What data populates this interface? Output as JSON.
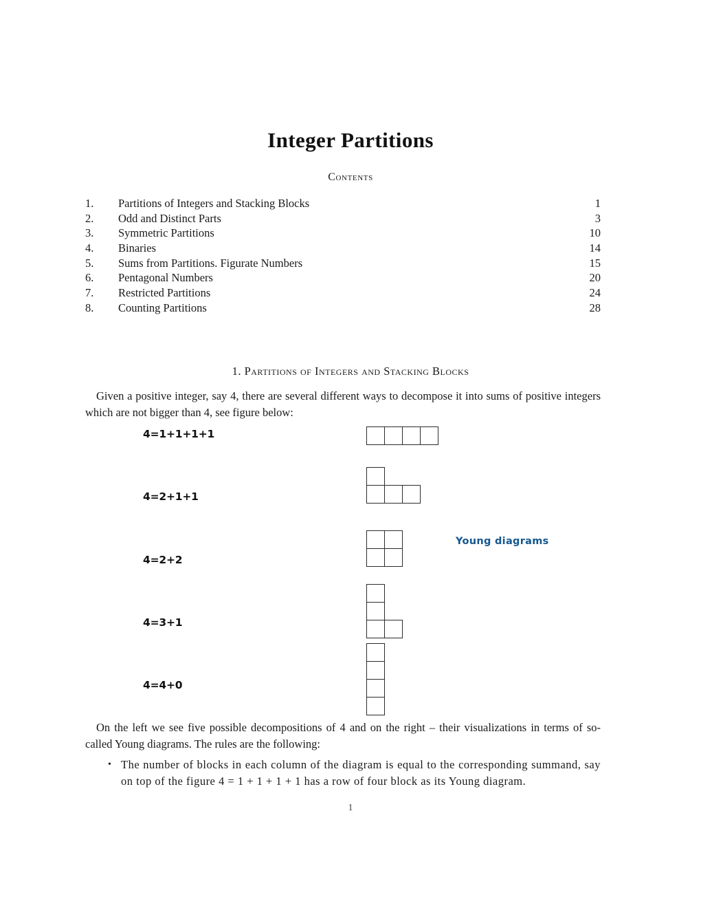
{
  "document": {
    "title": "Integer Partitions",
    "page_number": "1"
  },
  "contents": {
    "heading": "Contents",
    "entries": [
      {
        "number": "1.",
        "label": "Partitions of Integers and Stacking Blocks",
        "page": "1"
      },
      {
        "number": "2.",
        "label": "Odd and Distinct Parts",
        "page": "3"
      },
      {
        "number": "3.",
        "label": "Symmetric Partitions",
        "page": "10"
      },
      {
        "number": "4.",
        "label": "Binaries",
        "page": "14"
      },
      {
        "number": "5.",
        "label": "Sums from Partitions. Figurate Numbers",
        "page": "15"
      },
      {
        "number": "6.",
        "label": "Pentagonal Numbers",
        "page": "20"
      },
      {
        "number": "7.",
        "label": "Restricted Partitions",
        "page": "24"
      },
      {
        "number": "8.",
        "label": "Counting Partitions",
        "page": "28"
      }
    ]
  },
  "section": {
    "heading": "1. Partitions of Integers and Stacking Blocks",
    "intro_paragraph": "Given a positive integer, say 4, there are several different ways to decompose it into sums of positive integers which are not bigger than 4, see figure below:",
    "closing_paragraph": "On the left we see five possible decompositions of 4 and on the right – their visualizations in terms of so-called Young diagrams. The rules are the following:",
    "bullets": [
      "The number of blocks in each column of the diagram is equal to the corresponding summand, say on top of the figure 4 = 1 + 1 + 1 + 1 has a row of four block as its Young diagram."
    ]
  },
  "figure": {
    "caption": "Young diagrams",
    "caption_color": "#15578f",
    "cell_border_color": "#2b2b2b",
    "rows": [
      {
        "label": "4=1+1+1+1",
        "parts": [
          1,
          1,
          1,
          1
        ]
      },
      {
        "label": "4=2+1+1",
        "parts": [
          2,
          1,
          1
        ]
      },
      {
        "label": "4=2+2",
        "parts": [
          2,
          2
        ]
      },
      {
        "label": "4=3+1",
        "parts": [
          3,
          1
        ]
      },
      {
        "label": "4=4+0",
        "parts": [
          4
        ]
      }
    ]
  }
}
